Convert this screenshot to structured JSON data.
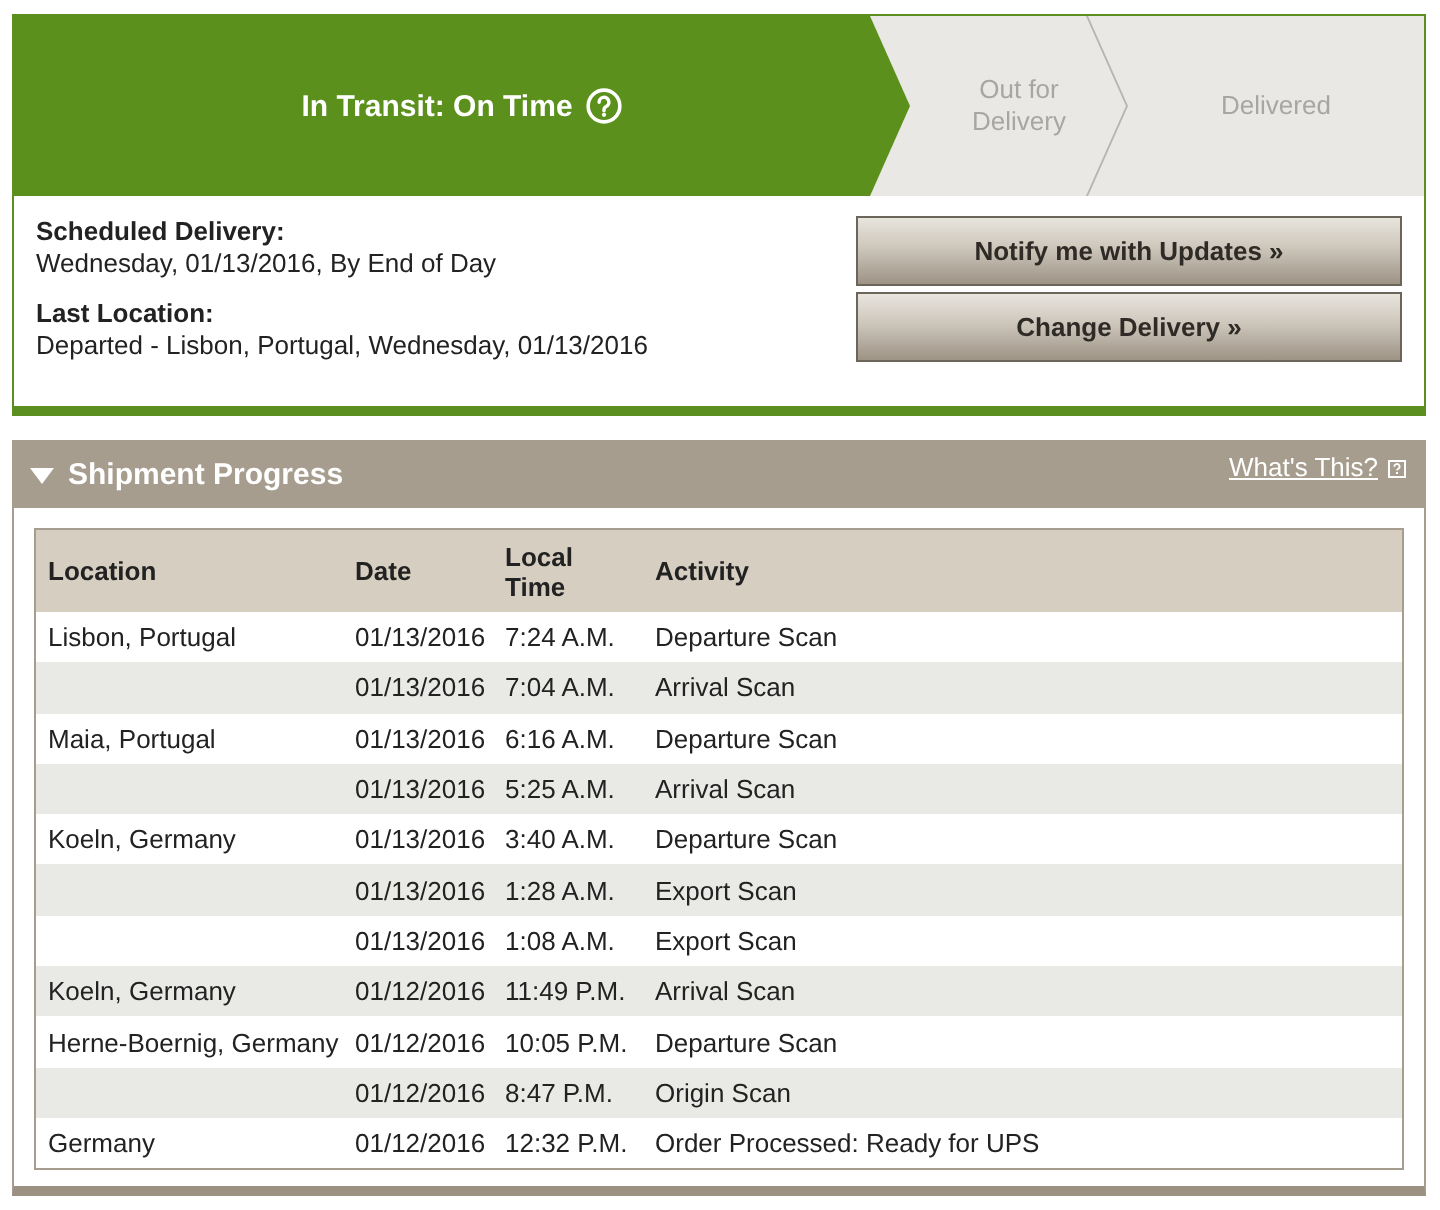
{
  "tracker": {
    "steps": [
      {
        "label": "In Transit: On Time",
        "current": true,
        "help": true
      },
      {
        "label": "Out for Delivery",
        "current": false,
        "help": false
      },
      {
        "label": "Delivered",
        "current": false,
        "help": false
      }
    ]
  },
  "details": [
    {
      "label": "Scheduled Delivery:",
      "value": "Wednesday, 01/13/2016, By End of Day"
    },
    {
      "label": "Last Location:",
      "value": "Departed - Lisbon, Portugal, Wednesday, 01/13/2016"
    }
  ],
  "actions": [
    "Notify me with Updates »",
    "Change Delivery »"
  ],
  "shipment_progress": {
    "title": "Shipment Progress",
    "expanded": true,
    "help_link": "What's This?",
    "columns": [
      "Location",
      "Date",
      "Local Time",
      "Activity"
    ],
    "rows": [
      {
        "location": "Lisbon, Portugal",
        "date": "01/13/2016",
        "time": "7:24 A.M.",
        "activity": "Departure Scan"
      },
      {
        "date": "01/13/2016",
        "time": "7:04 A.M.",
        "activity": "Arrival Scan"
      },
      {
        "location": "Maia, Portugal",
        "date": "01/13/2016",
        "time": "6:16 A.M.",
        "activity": "Departure Scan"
      },
      {
        "date": "01/13/2016",
        "time": "5:25 A.M.",
        "activity": "Arrival Scan"
      },
      {
        "location": "Koeln, Germany",
        "date": "01/13/2016",
        "time": "3:40 A.M.",
        "activity": "Departure Scan"
      },
      {
        "date": "01/13/2016",
        "time": "1:28 A.M.",
        "activity": "Export Scan"
      },
      {
        "date": "01/13/2016",
        "time": "1:08 A.M.",
        "activity": "Export Scan"
      },
      {
        "location": "Koeln, Germany",
        "date": "01/12/2016",
        "time": "11:49 P.M.",
        "activity": "Arrival Scan"
      },
      {
        "location": "Herne-Boernig, Germany",
        "date": "01/12/2016",
        "time": "10:05 P.M.",
        "activity": "Departure Scan"
      },
      {
        "date": "01/12/2016",
        "time": "8:47 P.M.",
        "activity": "Origin Scan"
      },
      {
        "location": "Germany",
        "date": "01/12/2016",
        "time": "12:32 P.M.",
        "activity": "Order Processed: Ready for UPS"
      }
    ]
  }
}
